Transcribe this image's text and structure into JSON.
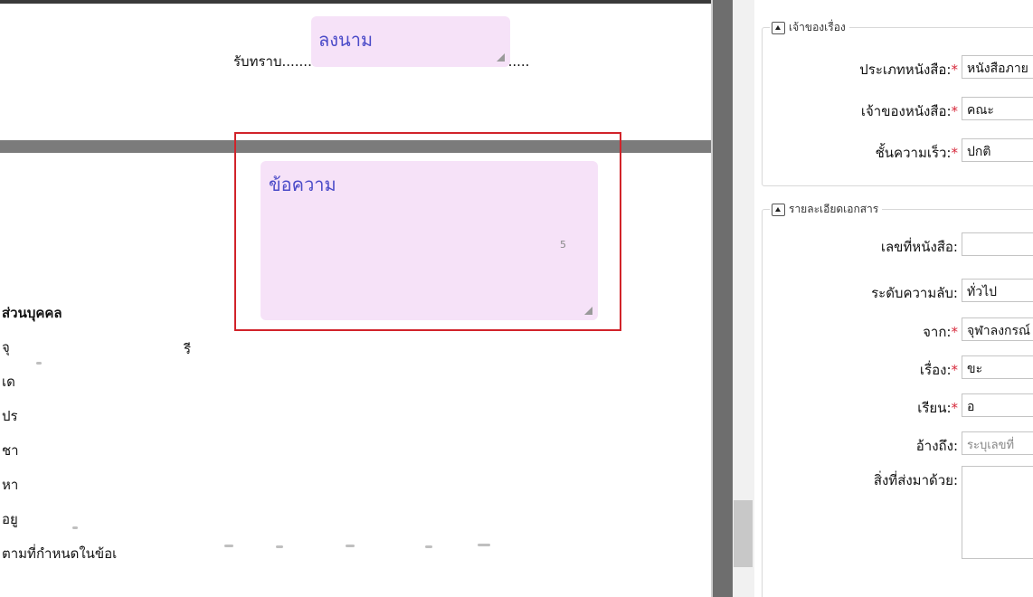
{
  "document": {
    "ack_prefix": "รับทราบ",
    "ack_dots_left": "...........",
    "ack_dots_right": "...............",
    "sign_placeholder": "ลงนาม",
    "message_placeholder": "ข้อความ",
    "message_counter": "5",
    "lines": [
      {
        "text": "ส่วนบุคคล",
        "bold": true
      },
      {
        "text": "จุ"
      },
      {
        "text": "เด"
      },
      {
        "text": "ปร"
      },
      {
        "text": "ชา"
      },
      {
        "text": "หา"
      },
      {
        "text": "อยู"
      },
      {
        "text": "ตามที่กำหนดในข้อเ"
      }
    ],
    "stray_char": "รี"
  },
  "form": {
    "owner_section": {
      "legend": "เจ้าของเรื่อง",
      "fields": [
        {
          "label": "ประเภทหนังสือ:",
          "required": true,
          "value": "หนังสือภาย"
        },
        {
          "label": "เจ้าของหนังสือ:",
          "required": true,
          "value": "คณะ"
        },
        {
          "label": "ชั้นความเร็ว:",
          "required": true,
          "value": "ปกติ"
        }
      ]
    },
    "details_section": {
      "legend": "รายละเอียดเอกสาร",
      "fields": [
        {
          "label": "เลขที่หนังสือ:",
          "required": false,
          "value": ""
        },
        {
          "label": "ระดับความลับ:",
          "required": false,
          "value": "ทั่วไป"
        },
        {
          "label": "จาก:",
          "required": true,
          "value": "จุฬาลงกรณ์"
        },
        {
          "label": "เรื่อง:",
          "required": true,
          "value": "ขะ"
        },
        {
          "label": "เรียน:",
          "required": true,
          "value": "อ"
        },
        {
          "label": "อ้างถึง:",
          "required": false,
          "placeholder": "ระบุเลขที่"
        },
        {
          "label": "สิ่งที่ส่งมาด้วย:",
          "required": false,
          "value": ""
        }
      ]
    },
    "required_mark": "*"
  },
  "colors": {
    "field_bg": "#f6e2f8",
    "field_text": "#4b4bc8",
    "highlight": "#d1232a",
    "required": "#d6283a"
  }
}
